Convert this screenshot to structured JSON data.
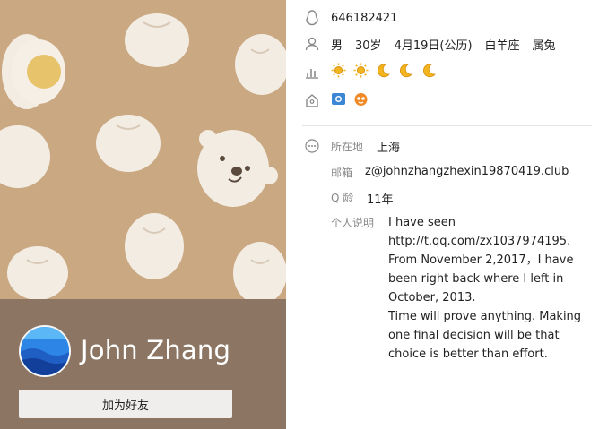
{
  "profile": {
    "nickname": "John Zhang",
    "add_friend_label": "加为好友",
    "qq_number": "646182421",
    "gender": "男",
    "age": "30岁",
    "birthday": "4月19日(公历)",
    "constellation": "白羊座",
    "zodiac": "属兔"
  },
  "level": {
    "icons": [
      "sun-icon",
      "sun-icon",
      "moon-icon",
      "moon-icon",
      "moon-icon"
    ]
  },
  "services": {
    "icons": [
      "qzone-photo-icon",
      "qq-pet-icon"
    ]
  },
  "details": {
    "location_label": "所在地",
    "location_value": "上海",
    "email_label": "邮箱",
    "email_value": "z@johnzhangzhexin19870419.club",
    "qage_label": "Q 龄",
    "qage_value": "11年",
    "bio_label": "个人说明",
    "bio_lines": [
      "I have seen http://t.qq.com/zx1037974195.",
      "From November 2,2017，I have been right back where I left in October, 2013.",
      "Time will prove anything. Making one final decision will be that choice is better than effort."
    ]
  },
  "colors": {
    "cover_bg": "#c9a882",
    "overlay": "#8c7663",
    "sun": "#f2b51d",
    "moon": "#f2b51d"
  }
}
